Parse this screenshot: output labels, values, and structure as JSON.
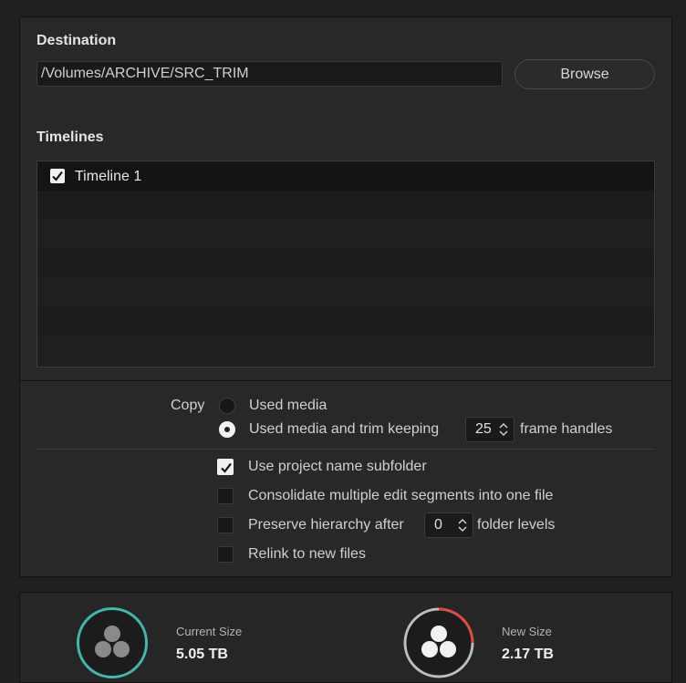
{
  "destination": {
    "label": "Destination",
    "path": "/Volumes/ARCHIVE/SRC_TRIM",
    "browse_label": "Browse"
  },
  "timelines": {
    "label": "Timelines",
    "items": [
      {
        "name": "Timeline 1",
        "checked": true
      }
    ]
  },
  "copy": {
    "label": "Copy",
    "option_used_media": "Used media",
    "option_trim": "Used media and trim keeping",
    "selected_option": "trim",
    "handles_value": "25",
    "handles_suffix": "frame handles"
  },
  "options": {
    "use_project_subfolder": {
      "label": "Use project name subfolder",
      "checked": true
    },
    "consolidate": {
      "label": "Consolidate multiple edit segments into one file",
      "checked": false
    },
    "preserve_hierarchy": {
      "label": "Preserve hierarchy after",
      "checked": false,
      "value": "0",
      "suffix": "folder levels"
    },
    "relink": {
      "label": "Relink to new files",
      "checked": false
    }
  },
  "stats": {
    "current_size_label": "Current Size",
    "current_size_value": "5.05 TB",
    "new_size_label": "New Size",
    "new_size_value": "2.17 TB",
    "colors": {
      "current_ring": "#3fb8b0",
      "new_ring_used": "#e0483a",
      "new_ring_rest": "#bdbdbd"
    },
    "icons": [
      "resolve-logo-icon",
      "resolve-logo-icon"
    ]
  }
}
